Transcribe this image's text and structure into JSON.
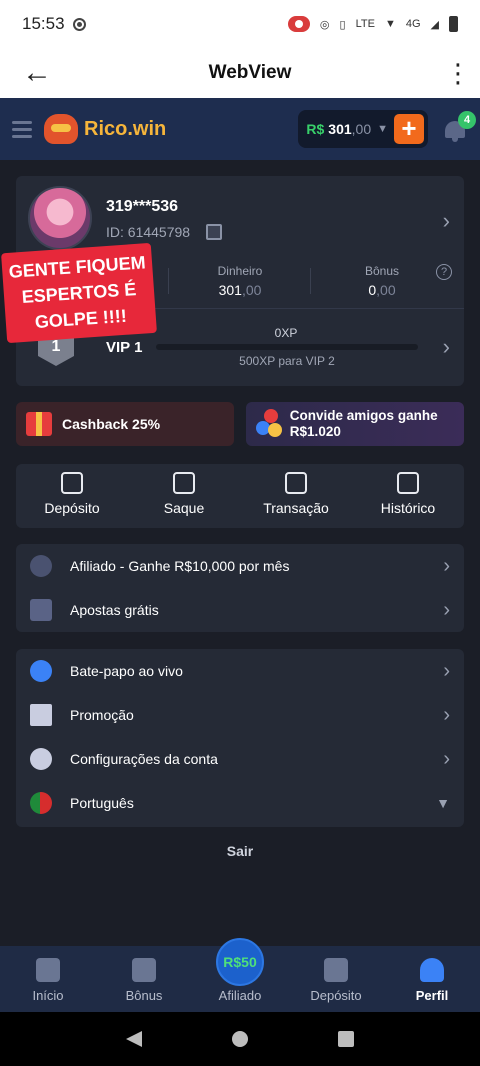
{
  "status_bar": {
    "time": "15:53",
    "network": "4G"
  },
  "app_bar": {
    "title": "WebView",
    "back_icon": "arrow-left-icon",
    "menu_icon": "more-vert-icon"
  },
  "header": {
    "logo_text": "Rico.win",
    "balance_currency": "R$",
    "balance_amount": "301",
    "balance_cents": ",00",
    "plus_label": "+",
    "notification_count": "4"
  },
  "profile": {
    "username": "319***536",
    "user_id": "ID: 61445798",
    "stats": [
      {
        "label": "Dinheiro",
        "value": "301",
        "decimals": ",00"
      },
      {
        "label": "Bônus",
        "value": "0",
        "decimals": ",00"
      }
    ],
    "vip": {
      "level": "1",
      "label": "VIP 1",
      "xp": "0XP",
      "xp_progress": 0,
      "next": "500XP para VIP 2"
    }
  },
  "overlay_warning": "GENTE FIQUEM ESPERTOS É GOLPE !!!!",
  "promos": {
    "cashback": "Cashback 25%",
    "invite": "Convide amigos ganhe R$1.020"
  },
  "actions": [
    {
      "label": "Depósito",
      "icon": "piggy-bank-icon"
    },
    {
      "label": "Saque",
      "icon": "withdraw-icon"
    },
    {
      "label": "Transação",
      "icon": "transaction-icon"
    },
    {
      "label": "Histórico",
      "icon": "history-icon"
    }
  ],
  "list_group_1": [
    {
      "label": "Afiliado - Ganhe R$10,000 por mês",
      "icon": "share-icon"
    },
    {
      "label": "Apostas grátis",
      "icon": "free-star-icon"
    }
  ],
  "list_group_2": [
    {
      "label": "Bate-papo ao vivo",
      "icon": "headset-icon"
    },
    {
      "label": "Promoção",
      "icon": "party-icon"
    },
    {
      "label": "Configurações da conta",
      "icon": "gear-icon"
    },
    {
      "label": "Português",
      "icon": "portugal-flag-icon"
    }
  ],
  "logout_label": "Sair",
  "bottom_nav": {
    "center_label": "R$50",
    "tabs": [
      {
        "label": "Início",
        "icon": "home-icon"
      },
      {
        "label": "Bônus",
        "icon": "gift-icon"
      },
      {
        "label": "Afiliado",
        "icon": "affiliate-icon"
      },
      {
        "label": "Depósito",
        "icon": "piggy-bank-icon"
      },
      {
        "label": "Perfil",
        "icon": "user-icon"
      }
    ]
  },
  "colors": {
    "accent": "#f6b53b",
    "brand_blue": "#1e2d4f",
    "warning_red": "#e7283a",
    "money_green": "#38d06a"
  }
}
